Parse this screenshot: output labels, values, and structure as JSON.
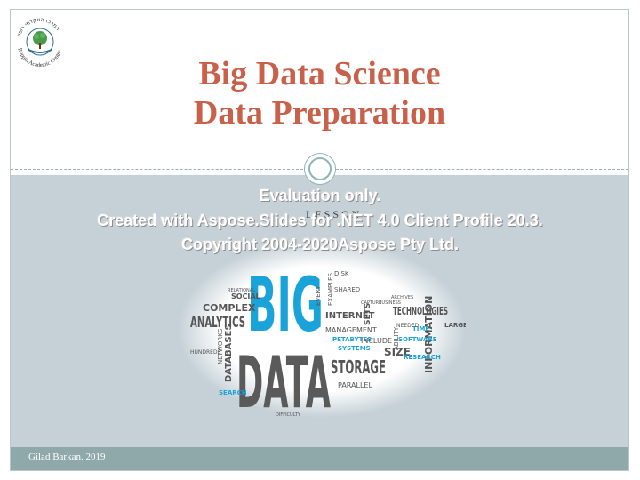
{
  "slide": {
    "title_line1": "Big Data Science",
    "title_line2": "Data Preparation",
    "footer": "Gilad Barkan. 2019",
    "lesson_label": "LESSON",
    "colors": {
      "title": "#c8604a",
      "bottom_band": "#c5d1d7",
      "footer_band": "#8fa9aa",
      "cloud_blue": "#1aa3d9",
      "cloud_gray": "#555555"
    }
  },
  "logo": {
    "icon": "tree-seal-icon",
    "text_english": "Ruppin Academic Center",
    "text_hebrew": "המרכז האקדמי רופין"
  },
  "watermark": {
    "line1": "Evaluation only.",
    "line2": "Created with Aspose.Slides for .NET 4.0 Client Profile 20.3.",
    "line3": "Copyright 2004-2020Aspose Pty Ltd."
  },
  "word_cloud": {
    "big": "BIG",
    "data": "DATA",
    "words": [
      "ANALYTICS",
      "COMPLEX",
      "TECHNOLOGIES",
      "STORAGE",
      "INTERNET",
      "MANAGEMENT",
      "DATABASES",
      "NETWORKS",
      "INFORMATION",
      "SOCIAL",
      "SIZE",
      "PARALLEL",
      "SEARCH",
      "SOFTWARE",
      "RESEARCH",
      "PETABYTES",
      "SYSTEMS",
      "INCLUDE",
      "SETS",
      "ABILITY",
      "EXAMPLES",
      "EVERY",
      "LARGE",
      "DIFFICULTY",
      "HUNDREDS",
      "TIME",
      "SHARED",
      "DISK",
      "RELATIONAL",
      "BUSINESS",
      "NEEDED",
      "CAPTURE",
      "ARCHIVES"
    ]
  }
}
